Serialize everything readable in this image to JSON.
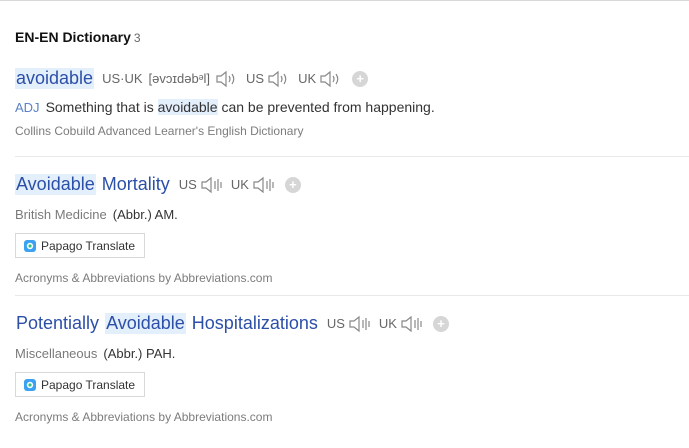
{
  "section": {
    "title": "EN-EN Dictionary",
    "count": "3"
  },
  "entries": [
    {
      "headword_parts": [
        "avoidable"
      ],
      "pron": {
        "label_usuk": "US·UK",
        "ipa": "[əvɔɪdəbᵊl]",
        "us": "US",
        "uk": "UK"
      },
      "pos": "ADJ",
      "def_before": "Something that is",
      "def_highlight": "avoidable",
      "def_after": "can be prevented from happening.",
      "source": "Collins Cobuild Advanced Learner's English Dictionary"
    },
    {
      "headword_parts": [
        "Avoidable",
        "Mortality"
      ],
      "pron": {
        "us": "US",
        "uk": "UK"
      },
      "field": "British Medicine",
      "abbr": "(Abbr.) AM.",
      "translate_label": "Papago Translate",
      "source": "Acronyms & Abbreviations by Abbreviations.com"
    },
    {
      "headword_parts": [
        "Potentially",
        "Avoidable",
        "Hospitalizations"
      ],
      "pron": {
        "us": "US",
        "uk": "UK"
      },
      "field": "Miscellaneous",
      "abbr": "(Abbr.) PAH.",
      "translate_label": "Papago Translate",
      "source": "Acronyms & Abbreviations by Abbreviations.com"
    }
  ],
  "icons": {
    "speaker": "speaker-icon",
    "add": "plus-icon",
    "papago": "papago-icon"
  },
  "colors": {
    "headword": "#2c4fa8",
    "highlight": "#e3effb",
    "pos": "#5b82c6"
  }
}
